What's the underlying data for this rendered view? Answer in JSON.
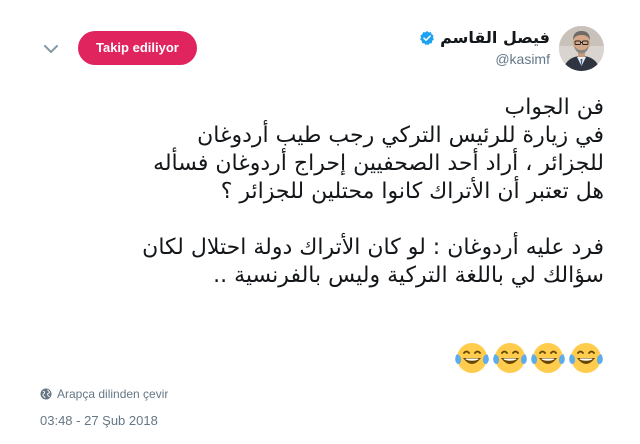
{
  "author": {
    "display_name": "فيصل القاسم",
    "username": "@kasimf",
    "verified": true
  },
  "actions": {
    "follow_label": "Takip ediliyor"
  },
  "tweet": {
    "lines": [
      "فن الجواب",
      "في زيارة للرئيس التركي رجب طيب أردوغان",
      "للجزائر ، أراد أحد الصحفيين إحراج أردوغان فسأله",
      "هل تعتبر أن الأتراك كانوا محتلين للجزائر ؟",
      "",
      "فرد عليه أردوغان : لو كان الأتراك دولة احتلال لكان",
      "سؤالك لي باللغة التركية وليس بالفرنسية .."
    ],
    "emoji_count": 4,
    "emoji_name": "face-with-tears-of-joy"
  },
  "footer": {
    "translate_label": "Arapça dilinden çevir",
    "timestamp": "03:48 - 27 Şub 2018"
  },
  "colors": {
    "follow_button_bg": "#e0245e",
    "verified_blue": "#1da1f2",
    "secondary_text": "#657786",
    "primary_text": "#14171a"
  }
}
